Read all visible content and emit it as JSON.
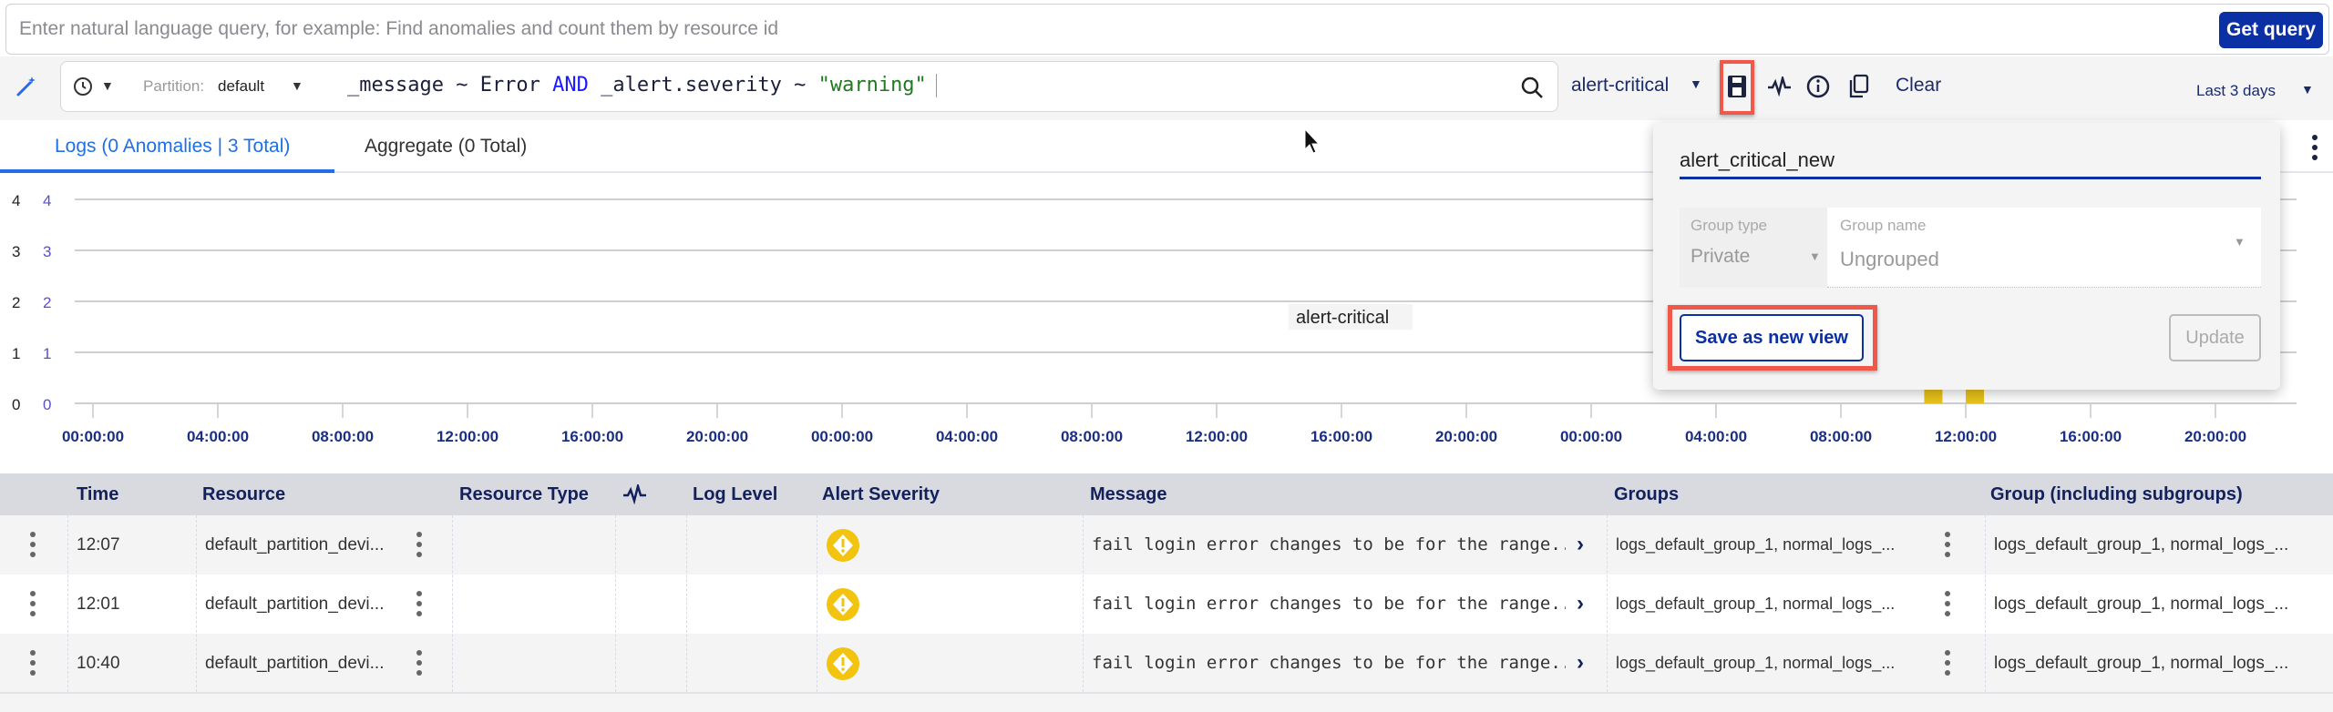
{
  "nl_query": {
    "placeholder": "Enter natural language query, for example: Find anomalies and count them by resource id",
    "button": "Get query"
  },
  "query_bar": {
    "partition_label": "Partition:",
    "partition_value": "default",
    "query_tokens": [
      {
        "text": "_message ~ Error ",
        "color": "#1b1f3b"
      },
      {
        "text": "AND",
        "color": "#1a1aff"
      },
      {
        "text": " _alert.severity ~ ",
        "color": "#1b1f3b"
      },
      {
        "text": "\"warning\"",
        "color": "#1f7a1f"
      }
    ],
    "saved_view": "alert-critical",
    "clear": "Clear",
    "time_range": "Last 3 days"
  },
  "tabs": [
    {
      "label": "Logs (0 Anomalies | 3 Total)",
      "active": true
    },
    {
      "label": "Aggregate (0 Total)",
      "active": false
    }
  ],
  "chart_data": {
    "type": "bar",
    "series_label": "alert-critical",
    "y_ticks_left": [
      "0",
      "1",
      "2",
      "3",
      "4"
    ],
    "y_ticks_right": [
      "0",
      "1",
      "2",
      "3",
      "4"
    ],
    "ylim": [
      0,
      4
    ],
    "x_ticks": [
      "00:00:00",
      "04:00:00",
      "08:00:00",
      "12:00:00",
      "16:00:00",
      "20:00:00",
      "00:00:00",
      "04:00:00",
      "08:00:00",
      "12:00:00",
      "16:00:00",
      "20:00:00",
      "00:00:00",
      "04:00:00",
      "08:00:00",
      "12:00:00",
      "16:00:00",
      "20:00:00"
    ],
    "bars": [
      {
        "hour": 58.67,
        "value": 1
      },
      {
        "hour": 60,
        "value": 2
      }
    ],
    "bar_color": "#e8c21a",
    "grid": true
  },
  "popup": {
    "view_name": "alert_critical_new",
    "group_type_label": "Group type",
    "group_type": "Private",
    "group_name_label": "Group name",
    "group_name": "Ungrouped",
    "save_new": "Save as new view",
    "update": "Update"
  },
  "table": {
    "headers": [
      "Time",
      "Resource",
      "Resource Type",
      "",
      "Log Level",
      "Alert Severity",
      "Message",
      "Groups",
      "Group (including subgroups)"
    ],
    "rows": [
      {
        "time": "12:07",
        "resource": "default_partition_devi...",
        "severity": "warning",
        "message": "fail login error changes to be for the range...",
        "groups": "logs_default_group_1, normal_logs_...",
        "groups_sub": "logs_default_group_1, normal_logs_..."
      },
      {
        "time": "12:01",
        "resource": "default_partition_devi...",
        "severity": "warning",
        "message": "fail login error changes to be for the range...",
        "groups": "logs_default_group_1, normal_logs_...",
        "groups_sub": "logs_default_group_1, normal_logs_..."
      },
      {
        "time": "10:40",
        "resource": "default_partition_devi...",
        "severity": "warning",
        "message": "fail login error changes to be for the range...",
        "groups": "logs_default_group_1, normal_logs_...",
        "groups_sub": "logs_default_group_1, normal_logs_..."
      }
    ]
  },
  "colors": {
    "accent": "#0b2fa5",
    "highlight": "#f0584a",
    "warning": "#f2c40f"
  }
}
